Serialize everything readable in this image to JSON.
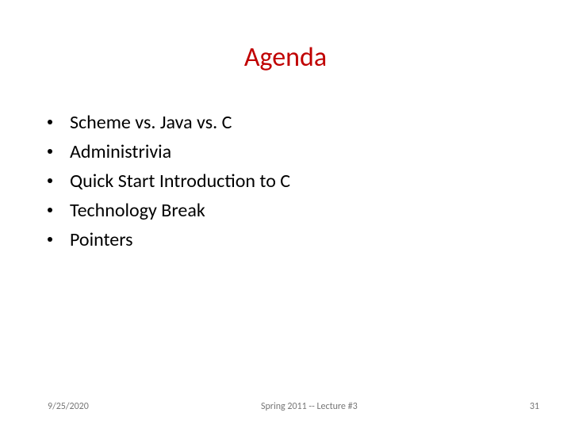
{
  "title": "Agenda",
  "items": [
    "Scheme vs. Java vs. C",
    "Administrivia",
    "Quick Start Introduction to C",
    "Technology Break",
    "Pointers"
  ],
  "footer": {
    "date": "9/25/2020",
    "center": "Spring 2011 -- Lecture #3",
    "page": "31"
  }
}
